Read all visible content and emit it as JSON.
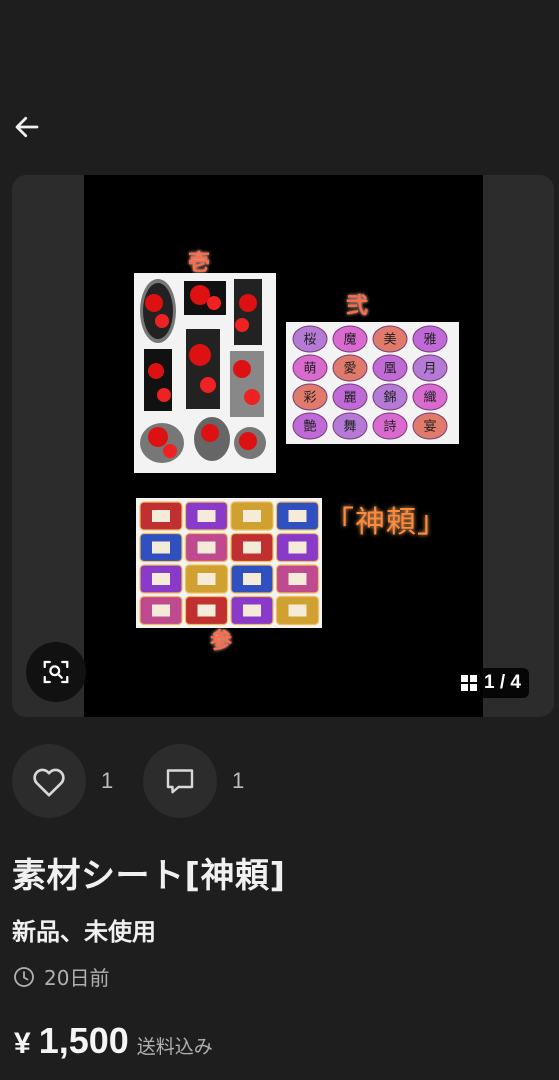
{
  "nav": {
    "back_icon": "arrow-left-icon"
  },
  "gallery": {
    "zoom_icon": "zoom-scan-icon",
    "grid_icon": "grid-icon",
    "counter": "1 / 4",
    "photo": {
      "label_1": "壱",
      "label_2": "弐",
      "label_3": "参",
      "brand": "「神頼」",
      "medallions": [
        "桜",
        "魔",
        "美",
        "雅",
        "萌",
        "愛",
        "凰",
        "月",
        "彩",
        "麗",
        "錦",
        "織",
        "艶",
        "舞",
        "詩",
        "宴"
      ]
    }
  },
  "actions": {
    "like_icon": "heart-icon",
    "like_count": "1",
    "comment_icon": "comment-icon",
    "comment_count": "1"
  },
  "item": {
    "title": "素材シート[神頼]",
    "condition": "新品、未使用",
    "posted": "20日前",
    "currency": "¥",
    "price": "1,500",
    "shipping": "送料込み"
  }
}
